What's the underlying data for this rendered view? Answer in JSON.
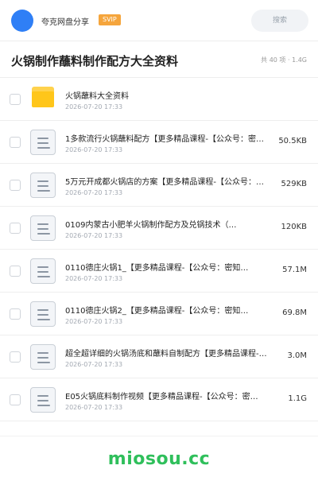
{
  "header": {
    "user_name": "夸克网盘分享",
    "vip_badge": "SVIP",
    "search_placeholder": "搜索"
  },
  "page": {
    "title": "火锅制作蘸料制作配方大全资料",
    "meta": "共 40 项 · 1.4G"
  },
  "files": [
    {
      "type": "folder",
      "name": "火锅蘸料大全资料",
      "date": "2026-07-20 17:33",
      "size": ""
    },
    {
      "type": "doc",
      "name": "1多款流行火锅蘸料配方【更多精品课程-【公众号：密…",
      "date": "2026-07-20 17:33",
      "size": "50.5KB"
    },
    {
      "type": "doc",
      "name": "5万元开成都火锅店的方案【更多精品课程-【公众号：…",
      "date": "2026-07-20 17:33",
      "size": "529KB"
    },
    {
      "type": "doc",
      "name": "0109内蒙古小肥羊火锅制作配方及兑锅技术（…",
      "date": "2026-07-20 17:33",
      "size": "120KB"
    },
    {
      "type": "doc",
      "name": "0110德庄火锅1_【更多精品课程-【公众号：密知…",
      "date": "2026-07-20 17:33",
      "size": "57.1M"
    },
    {
      "type": "doc",
      "name": "0110德庄火锅2_【更多精品课程-【公众号：密知…",
      "date": "2026-07-20 17:33",
      "size": "69.8M"
    },
    {
      "type": "doc",
      "name": "超全超详细的火锅汤底和蘸料自制配方【更多精品课程-…",
      "date": "2026-07-20 17:33",
      "size": "3.0M"
    },
    {
      "type": "doc",
      "name": "E05火锅底料制作视频【更多精品课程-【公众号：密…",
      "date": "2026-07-20 17:33",
      "size": "1.1G"
    }
  ],
  "footer": {
    "brand": "miosou.cc"
  },
  "colors": {
    "accent": "#2f7ff6",
    "vip": "#f5a53c",
    "folder": "#ffc61a",
    "brand": "#2fbf5b"
  }
}
